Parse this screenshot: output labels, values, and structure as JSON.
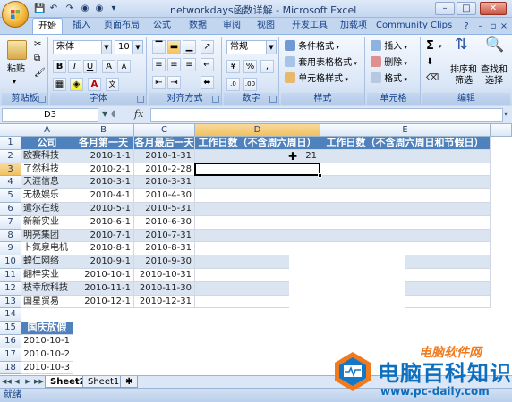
{
  "window": {
    "title": "networkdays函数详解 - Microsoft Excel",
    "controls": [
      "–",
      "□",
      "✕"
    ]
  },
  "tabs": [
    "开始",
    "插入",
    "页面布局",
    "公式",
    "数据",
    "审阅",
    "视图",
    "开发工具",
    "加载项",
    "Community Clips"
  ],
  "ribbon": {
    "clipboard": {
      "paste": "粘贴",
      "label": "剪贴板"
    },
    "font": {
      "name": "宋体",
      "size": "10",
      "label": "字体",
      "bold": "B",
      "italic": "I",
      "underline": "U"
    },
    "alignment": {
      "label": "对齐方式"
    },
    "number": {
      "format": "常规",
      "percent": "%",
      "comma": ",",
      "label": "数字"
    },
    "styles": {
      "conditional": "条件格式",
      "table": "套用表格格式",
      "cell": "单元格样式",
      "label": "样式"
    },
    "cells": {
      "insert": "插入",
      "delete": "删除",
      "format": "格式",
      "label": "单元格"
    },
    "editing": {
      "sigma": "Σ",
      "sort": "排序和筛选",
      "find": "查找和选择",
      "label": "编辑"
    }
  },
  "formula_bar": {
    "name_box": "D3",
    "fx": "fx",
    "value": ""
  },
  "sheet": {
    "columns": [
      "A",
      "B",
      "C",
      "D",
      "E"
    ],
    "rows": [
      "1",
      "2",
      "3",
      "4",
      "5",
      "6",
      "7",
      "8",
      "9",
      "10",
      "11",
      "12",
      "13",
      "14",
      "15",
      "16",
      "17",
      "18"
    ],
    "headers": [
      "公司",
      "各月第一天",
      "各月最后一天",
      "工作日数（不含周六周日）",
      "工作日数（不含周六周日和节假日）"
    ],
    "data": [
      [
        "欧赛科技",
        "2010-1-1",
        "2010-1-31",
        "21",
        ""
      ],
      [
        "了然科技",
        "2010-2-1",
        "2010-2-28",
        "",
        ""
      ],
      [
        "天涯信息",
        "2010-3-1",
        "2010-3-31",
        "",
        ""
      ],
      [
        "无极娱乐",
        "2010-4-1",
        "2010-4-30",
        "",
        ""
      ],
      [
        "遣尔在线",
        "2010-5-1",
        "2010-5-31",
        "",
        ""
      ],
      [
        "新新实业",
        "2010-6-1",
        "2010-6-30",
        "",
        ""
      ],
      [
        "明亮集团",
        "2010-7-1",
        "2010-7-31",
        "",
        ""
      ],
      [
        "卜氮泉电机",
        "2010-8-1",
        "2010-8-31",
        "",
        ""
      ],
      [
        "蝗仁网络",
        "2010-9-1",
        "2010-9-30",
        "",
        ""
      ],
      [
        "翻梓实业",
        "2010-10-1",
        "2010-10-31",
        "",
        ""
      ],
      [
        "枝幸欣科技",
        "2010-11-1",
        "2010-11-30",
        "",
        ""
      ],
      [
        "国星贸易",
        "2010-12-1",
        "2010-12-31",
        "",
        ""
      ]
    ],
    "holiday_header": "国庆放假",
    "holidays": [
      "2010-10-1",
      "2010-10-2",
      "2010-10-3"
    ]
  },
  "sheet_tabs": [
    "Sheet2",
    "Sheet1"
  ],
  "status": "就绪",
  "watermark": {
    "top": "电脑软件网",
    "title": "电脑百科知识",
    "url": "www.pc-daily.com"
  },
  "colors": {
    "header_fill": "#4f81bd",
    "band_fill": "#dbe5f1",
    "active_tab": "#ffffff"
  }
}
